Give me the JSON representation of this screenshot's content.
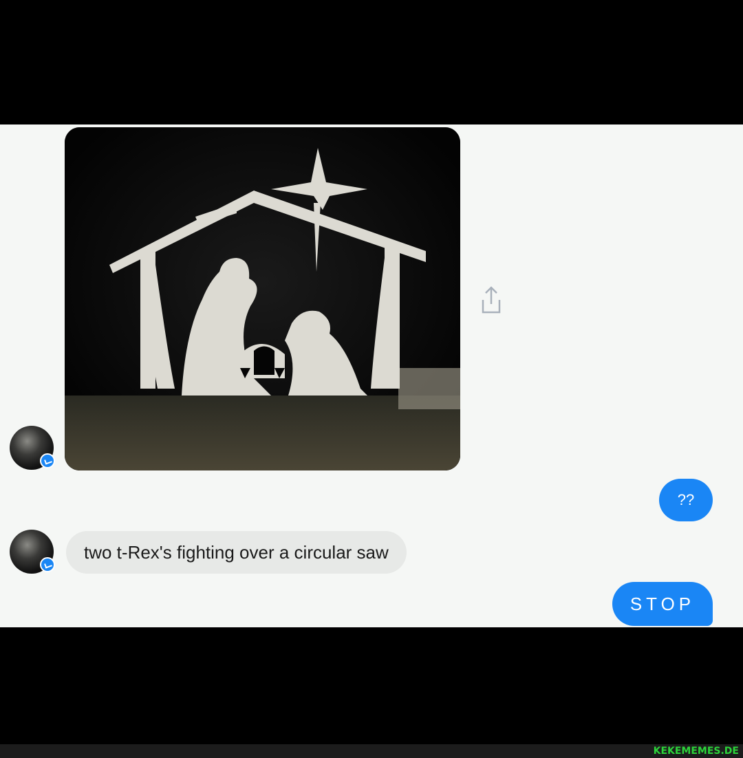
{
  "conversation": {
    "messages": [
      {
        "from": "them",
        "kind": "image",
        "image_icon": "nativity-scene-photo"
      },
      {
        "from": "me",
        "text": "??"
      },
      {
        "from": "them",
        "text": "two t-Rex's fighting over a circular saw"
      },
      {
        "from": "me",
        "text": "STOP"
      }
    ],
    "share_icon": "share-icon"
  },
  "colors": {
    "outgoing_bubble": "#1a86f5",
    "incoming_bubble": "#e7e9e7",
    "chat_background": "#f5f7f5",
    "watermark": "#2cd43a"
  },
  "watermark": "KEKEMEMES.DE"
}
